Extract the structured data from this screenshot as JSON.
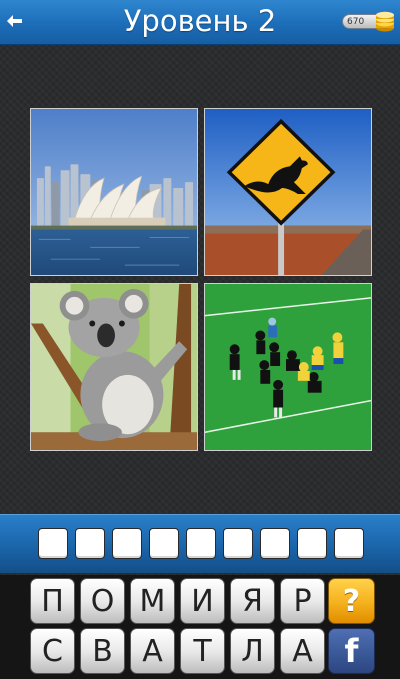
{
  "header": {
    "title": "Уровень 2",
    "coins": "670",
    "back_icon": "back-arrow-icon",
    "coin_icon": "coin-stack-icon",
    "bar_color": "#1d6db8"
  },
  "pictures": [
    {
      "subject": "sydney-opera-house"
    },
    {
      "subject": "kangaroo-road-sign"
    },
    {
      "subject": "koala"
    },
    {
      "subject": "rugby-match"
    }
  ],
  "answer": {
    "slot_count": 9,
    "letters": [
      "",
      "",
      "",
      "",
      "",
      "",
      "",
      "",
      ""
    ]
  },
  "keyboard": {
    "row1": [
      "П",
      "О",
      "М",
      "И",
      "Я",
      "Р"
    ],
    "row2": [
      "С",
      "В",
      "А",
      "Т",
      "Л",
      "А"
    ],
    "hint_label": "?",
    "facebook_label": "f",
    "hint_color": "#f5b01d",
    "facebook_color": "#3b5998"
  }
}
